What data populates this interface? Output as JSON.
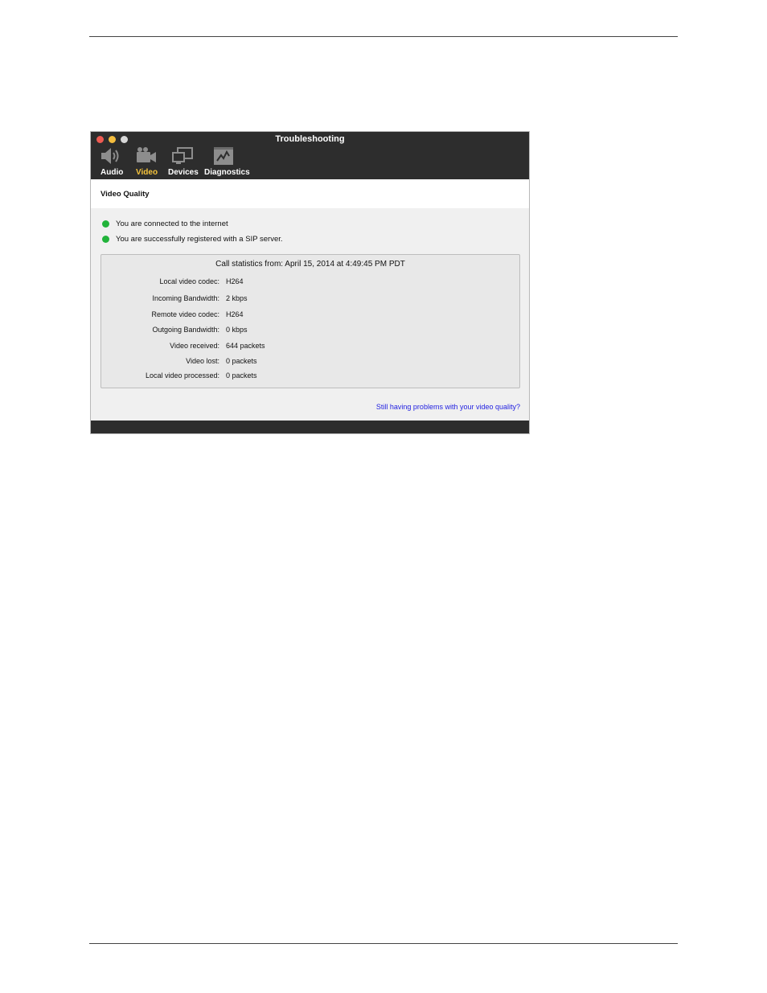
{
  "window": {
    "title": "Troubleshooting",
    "tabs": [
      {
        "label": "Audio",
        "icon": "speaker-icon"
      },
      {
        "label": "Video",
        "icon": "video-camera-icon",
        "active": true
      },
      {
        "label": "Devices",
        "icon": "monitor-icon"
      },
      {
        "label": "Diagnostics",
        "icon": "chart-icon"
      }
    ]
  },
  "section": {
    "title": "Video Quality"
  },
  "status": [
    {
      "text": "You are connected to the internet",
      "color": "#21b33a"
    },
    {
      "text": "You are successfully registered with a SIP server.",
      "color": "#21b33a"
    }
  ],
  "stats": {
    "heading": "Call statistics from: April 15, 2014 at 4:49:45 PM PDT",
    "rows": [
      {
        "label": "Local video codec:",
        "value": "H264"
      },
      {
        "label": "Incoming Bandwidth:",
        "value": "2 kbps"
      },
      {
        "label": "Remote video codec:",
        "value": "H264"
      },
      {
        "label": "Outgoing Bandwidth:",
        "value": "0 kbps"
      },
      {
        "label": "Video received:",
        "value": "644 packets"
      },
      {
        "label": "Video lost:",
        "value": "0 packets"
      },
      {
        "label": "Local video processed:",
        "value": "0 packets"
      }
    ]
  },
  "help_link": "Still having problems with your video quality?",
  "colors": {
    "accent": "#f5c33b",
    "link": "#1f1ee0",
    "titlebar": "#2d2d2d"
  }
}
